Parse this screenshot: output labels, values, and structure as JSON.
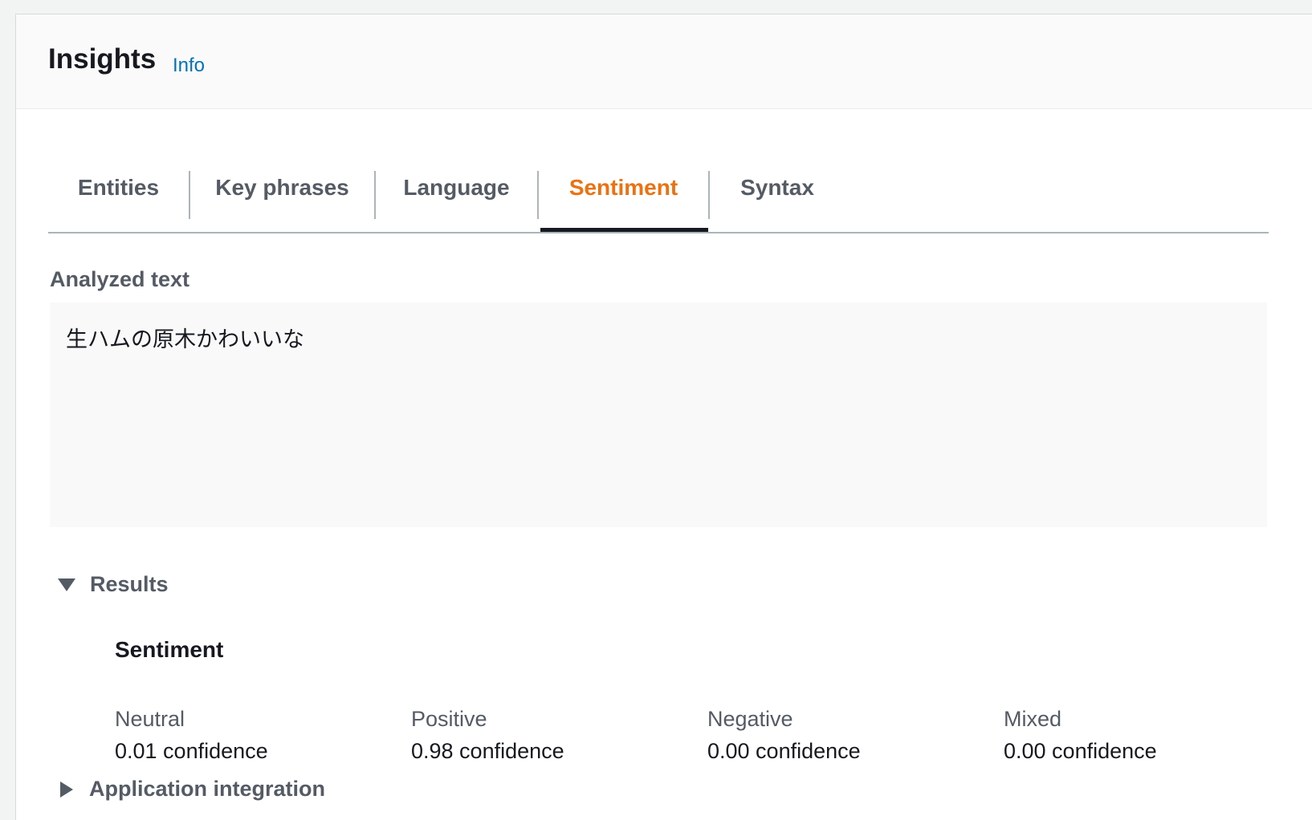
{
  "header": {
    "title": "Insights",
    "info_link": "Info"
  },
  "tabs": [
    {
      "label": "Entities",
      "active": false
    },
    {
      "label": "Key phrases",
      "active": false
    },
    {
      "label": "Language",
      "active": false
    },
    {
      "label": "Sentiment",
      "active": true
    },
    {
      "label": "Syntax",
      "active": false
    }
  ],
  "analyzed": {
    "label": "Analyzed text",
    "text": "生ハムの原木かわいいな"
  },
  "results": {
    "label": "Results",
    "expanded": true,
    "sentiment_title": "Sentiment",
    "scores": [
      {
        "label": "Neutral",
        "value": "0.01 confidence"
      },
      {
        "label": "Positive",
        "value": "0.98 confidence"
      },
      {
        "label": "Negative",
        "value": "0.00 confidence"
      },
      {
        "label": "Mixed",
        "value": "0.00 confidence"
      }
    ]
  },
  "app_integration": {
    "label": "Application integration",
    "expanded": false
  },
  "colors": {
    "active_tab": "#ec7211",
    "link": "#0073bb",
    "text": "#16191f",
    "muted_text": "#545b64"
  },
  "icons": {
    "results_toggle": "caret-down-icon",
    "app_integration_toggle": "caret-right-icon"
  }
}
